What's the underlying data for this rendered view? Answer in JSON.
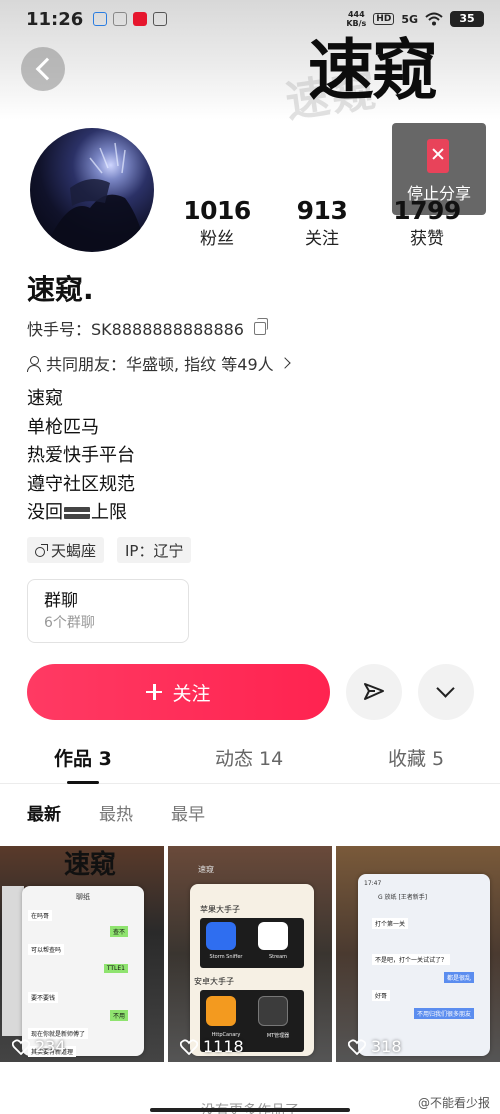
{
  "status_bar": {
    "time": "11:26",
    "net_speed_top": "444",
    "net_speed_bottom": "KB/s",
    "hd": "HD",
    "signal": "5G",
    "battery": "35"
  },
  "header": {
    "watermark_text": "速窥",
    "share_label": "停止分享"
  },
  "stats": [
    {
      "value": "1016",
      "label": "粉丝"
    },
    {
      "value": "913",
      "label": "关注"
    },
    {
      "value": "1799",
      "label": "获赞"
    }
  ],
  "profile": {
    "name": "速窥.",
    "kuaishou_id_label": "快手号：SK8888888888886",
    "friends_prefix": "共同朋友：华盛顿, 指纹 等49人",
    "bio": [
      "速窥",
      "单枪匹马",
      "热爱快手平台",
      "遵守社区规范"
    ],
    "bio_last_before": "没回",
    "bio_last_after": "上限",
    "tag_zodiac": "天蝎座",
    "tag_ip": "IP：辽宁"
  },
  "group_chat": {
    "title": "群聊",
    "subtitle": "6个群聊"
  },
  "actions": {
    "follow_label": "关注"
  },
  "tabs": [
    {
      "label": "作品 3",
      "active": true
    },
    {
      "label": "动态 14",
      "active": false
    },
    {
      "label": "收藏 5",
      "active": false
    }
  ],
  "subtabs": [
    {
      "label": "最新",
      "active": true
    },
    {
      "label": "最热",
      "active": false
    },
    {
      "label": "最早",
      "active": false
    }
  ],
  "works": [
    {
      "likes": "234",
      "chat_title": "聊纸",
      "messages": [
        "在吗哥",
        "可以帮查吗",
        "要不要钱",
        "现在你就是新师傅了",
        "其实要有新道理"
      ],
      "replies": [
        "查不",
        "TTLE1",
        "不用"
      ]
    },
    {
      "likes": "1118",
      "top_label": "速窥",
      "section_1": "苹果大手子",
      "app_1": "Storm Sniffer",
      "app_2": "Stream",
      "section_2": "安卓大手子",
      "app_3": "HttpCanary",
      "app_4": "MT管理器"
    },
    {
      "likes": "318",
      "chat_time": "17:47",
      "chat_title": "G 放纸 [王者新手]",
      "messages": [
        "打个第一关",
        "不是吧，打个一关试试了？",
        "好哥"
      ],
      "replies": [
        "都是很乱",
        "不用归我们很多朋友"
      ]
    }
  ],
  "footer": {
    "no_more_text": "没有更多作品了",
    "weibo_watermark": "@不能看少报"
  },
  "colors": {
    "accent": "#ff2c55",
    "tag_bg": "#f2f2f2"
  }
}
